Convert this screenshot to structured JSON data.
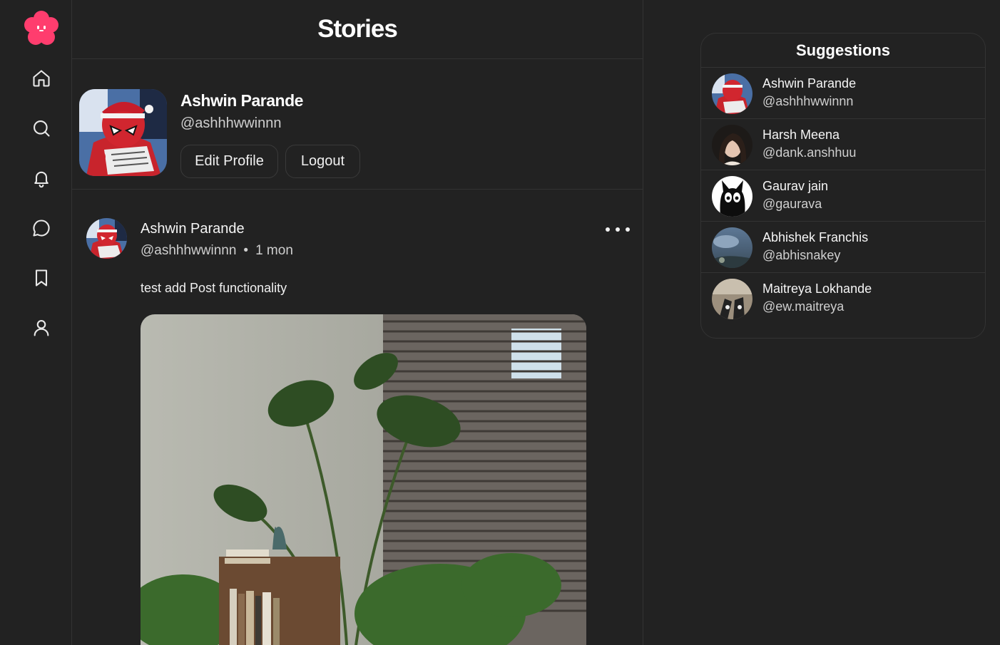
{
  "colors": {
    "background": "#222222",
    "border": "#333333",
    "brand": "#ff3d6e",
    "text": "#f2f2f2",
    "muted": "#cfcfcf"
  },
  "sidebar": {
    "logo": "flower-logo",
    "items": [
      {
        "icon": "home-icon"
      },
      {
        "icon": "search-icon"
      },
      {
        "icon": "bell-icon"
      },
      {
        "icon": "chat-bubble-icon"
      },
      {
        "icon": "bookmark-icon"
      },
      {
        "icon": "user-icon"
      }
    ]
  },
  "stories": {
    "title": "Stories"
  },
  "profile": {
    "name": "Ashwin Parande",
    "handle": "@ashhhwwinnn",
    "edit_label": "Edit Profile",
    "logout_label": "Logout"
  },
  "post": {
    "author": "Ashwin Parande",
    "handle": "@ashhhwwinnn",
    "separator": "•",
    "time": "1 mon",
    "text": "test add Post functionality",
    "image": "monstera-plants-window-photo"
  },
  "suggestions": {
    "title": "Suggestions",
    "users": [
      {
        "name": "Ashwin Parande",
        "handle": "@ashhhwwinnn"
      },
      {
        "name": "Harsh Meena",
        "handle": "@dank.anshhuu"
      },
      {
        "name": "Gaurav jain",
        "handle": "@gaurava"
      },
      {
        "name": "Abhishek Franchis",
        "handle": "@abhisnakey"
      },
      {
        "name": "Maitreya Lokhande",
        "handle": "@ew.maitreya"
      }
    ]
  }
}
